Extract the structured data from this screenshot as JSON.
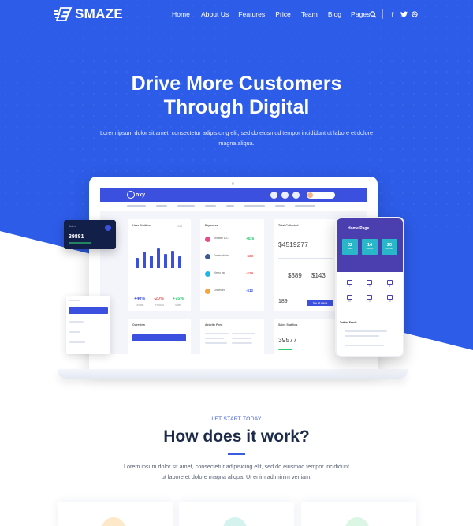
{
  "brand": {
    "name": "SMAZE",
    "accent": "#2d5ce8"
  },
  "nav": {
    "items": [
      "Home",
      "About Us",
      "Features",
      "Price",
      "Team",
      "Blog",
      "Pages"
    ],
    "icons": [
      "search-icon",
      "facebook-icon",
      "twitter-icon",
      "dribbble-icon"
    ]
  },
  "hero": {
    "title_line1": "Drive More Customers",
    "title_line2": "Through Digital",
    "subtitle": "Lorem ipsum dolor sit amet, consectetur adipisicing elit, sed do eiusmod tempor incididunt ut labore et dolore magna aliqua."
  },
  "mockup": {
    "app_name": "oxy",
    "user_stats": {
      "title": "User Statitics",
      "year": "2018",
      "p1": "+40%",
      "p2": "-20%",
      "p3": "+75%",
      "l1": "Growth",
      "l2": "Product",
      "l3": "Sales",
      "bars": [
        0.45,
        0.7,
        0.55,
        0.85,
        0.6,
        0.75,
        0.5
      ]
    },
    "expenses": {
      "title": "Expenses",
      "items": [
        {
          "name": "Dribbble LLC",
          "amt": "+$26",
          "color": "#e84a8a",
          "amt_color": "#2fcc71"
        },
        {
          "name": "Facebook Inc",
          "amt": "-$23",
          "color": "#3b5998",
          "amt_color": "#f25c5c"
        },
        {
          "name": "Vimeo Inc",
          "amt": "-$19",
          "color": "#1ab7ea",
          "amt_color": "#f25c5c"
        },
        {
          "name": "Chevrolet",
          "amt": "-$12",
          "color": "#f7a53b",
          "amt_color": "#3c50e0"
        }
      ]
    },
    "total": {
      "title": "Total Collected",
      "value": "$4519277",
      "outstanding": "$389",
      "overdue": "$143",
      "total_clients": "189",
      "clients_btn": "See all clients"
    },
    "sales": {
      "title": "Sales Statitics",
      "value": "39577"
    },
    "overview": {
      "title": "Overview"
    },
    "activity": {
      "title": "Activity Feed"
    },
    "dark_card": {
      "label": "Sales",
      "value": "39881"
    },
    "phone": {
      "title": "Home Page",
      "tiles": [
        {
          "n": "02",
          "l": "Sales"
        },
        {
          "n": "14",
          "l": "Ratings"
        },
        {
          "n": "20",
          "l": "Minutes"
        }
      ],
      "feed_title": "Twitter Feeds"
    }
  },
  "how": {
    "kicker": "LET START TODAY",
    "title": "How does it work?",
    "subtitle": "Lorem ipsum dolor sit amet, consectetur adipisicing elit, sed do eiusmod tempor incididunt ut labore et dolore magna aliqua. Ut enim ad minim veniam."
  }
}
